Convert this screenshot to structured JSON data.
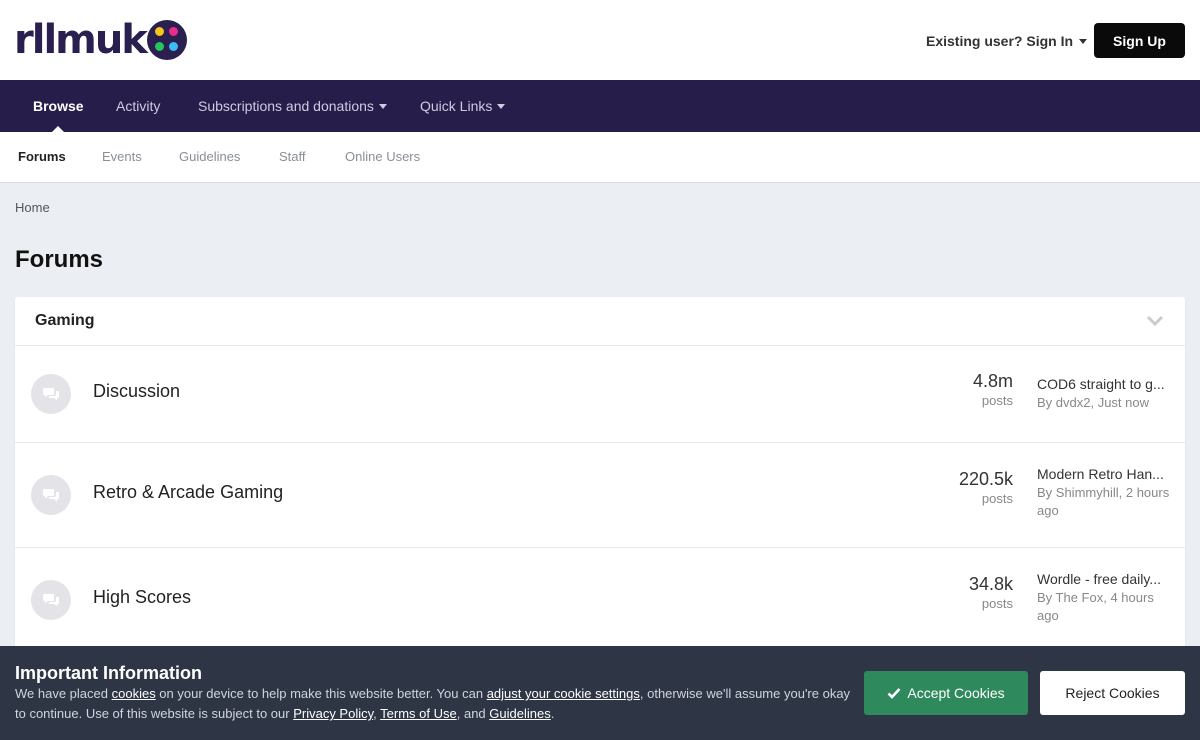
{
  "header": {
    "logo_text": "rllmuk",
    "signin_label": "Existing user? Sign In",
    "signup_label": "Sign Up"
  },
  "primary_nav": [
    {
      "label": "Browse",
      "active": true,
      "dropdown": false
    },
    {
      "label": "Activity",
      "active": false,
      "dropdown": false
    },
    {
      "label": "Subscriptions and donations",
      "active": false,
      "dropdown": true
    },
    {
      "label": "Quick Links",
      "active": false,
      "dropdown": true
    }
  ],
  "secondary_nav": [
    {
      "label": "Forums",
      "active": true
    },
    {
      "label": "Events",
      "active": false
    },
    {
      "label": "Guidelines",
      "active": false
    },
    {
      "label": "Staff",
      "active": false
    },
    {
      "label": "Online Users",
      "active": false
    }
  ],
  "breadcrumb": "Home",
  "page_title": "Forums",
  "category": {
    "title": "Gaming",
    "forums": [
      {
        "name": "Discussion",
        "count": "4.8m",
        "count_label": "posts",
        "last_title": "COD6 straight to g...",
        "last_meta": "By dvdx2, Just now"
      },
      {
        "name": "Retro & Arcade Gaming",
        "count": "220.5k",
        "count_label": "posts",
        "last_title": "Modern Retro Han...",
        "last_meta": "By Shimmyhill, 2 hours ago"
      },
      {
        "name": "High Scores",
        "count": "34.8k",
        "count_label": "posts",
        "last_title": "Wordle - free daily...",
        "last_meta": "By The Fox, 4 hours ago"
      }
    ]
  },
  "cookie": {
    "title": "Important Information",
    "text_1": "We have placed ",
    "link_cookies": "cookies",
    "text_2": " on your device to help make this website better. You can ",
    "link_settings": "adjust your cookie settings",
    "text_3": ", otherwise we'll assume you're okay to continue. Use of this website is subject to our ",
    "link_privacy": "Privacy Policy",
    "text_4": ", ",
    "link_terms": "Terms of Use",
    "text_5": ", and ",
    "link_guidelines": "Guidelines",
    "text_6": ".",
    "accept_label": "Accept Cookies",
    "reject_label": "Reject Cookies"
  },
  "colors": {
    "brand": "#261d4a",
    "accept": "#2e8a5d",
    "cookie_bg": "#2e3545",
    "logo_dots": [
      "#f5c518",
      "#ea2b8a",
      "#22c55e",
      "#38bdf8"
    ]
  }
}
